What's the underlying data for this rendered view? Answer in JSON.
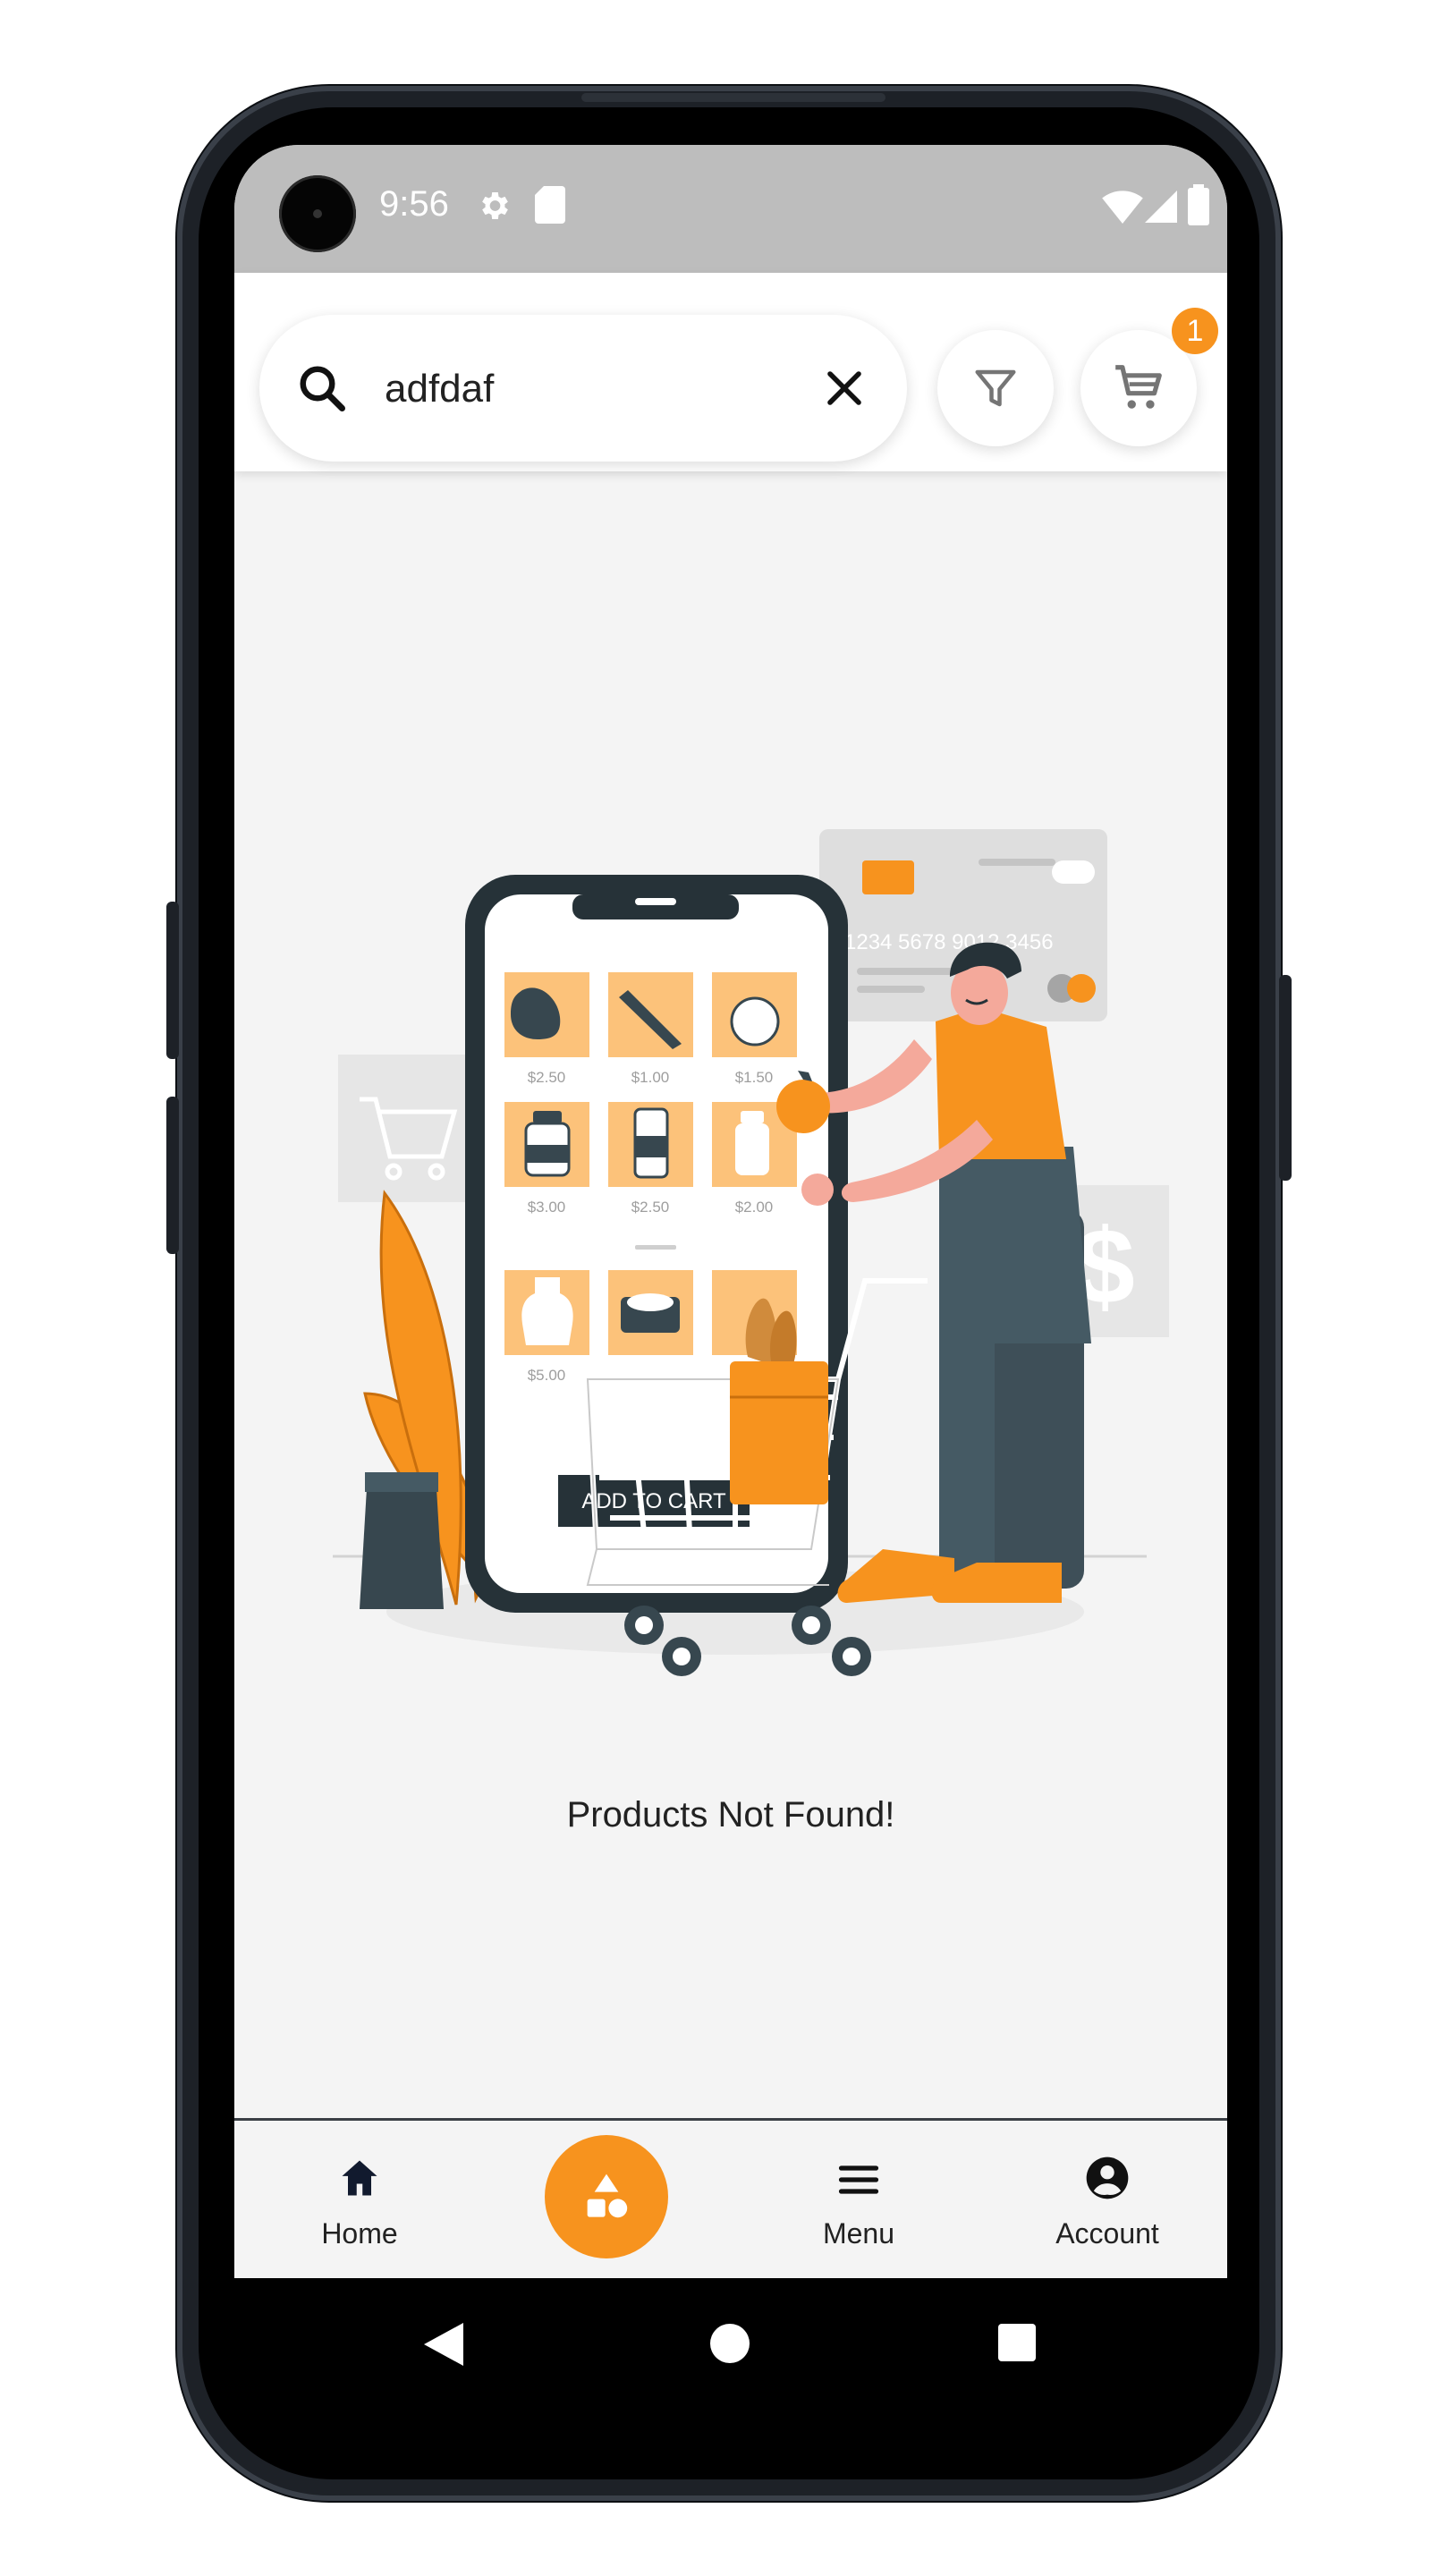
{
  "status_bar": {
    "time": "9:56"
  },
  "search": {
    "value": "adfdaf"
  },
  "cart": {
    "badge_count": "1"
  },
  "illustration": {
    "prices": [
      "$2.50",
      "$1.00",
      "$1.50",
      "$3.00",
      "$2.50",
      "$2.00",
      "$5.00"
    ],
    "card_number": "1234 5678 9012 3456",
    "add_to_cart": "ADD TO CART",
    "dollar_sign": "$"
  },
  "empty_state": {
    "message": "Products Not Found!"
  },
  "bottom_nav": {
    "items": [
      {
        "label": "Home",
        "icon": "home-icon"
      },
      {
        "label": "",
        "icon": "shapes-icon"
      },
      {
        "label": "Menu",
        "icon": "menu-icon"
      },
      {
        "label": "Account",
        "icon": "account-icon"
      }
    ]
  },
  "colors": {
    "accent": "#f7931e",
    "illustration_dark": "#37474f",
    "status_bar": "#bdbdbd"
  }
}
